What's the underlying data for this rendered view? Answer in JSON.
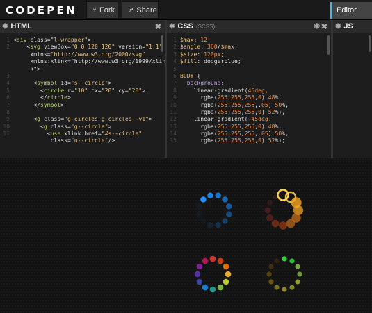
{
  "app": {
    "logo_text": "CODEPEN"
  },
  "toolbar": {
    "fork_label": "Fork",
    "share_label": "Share",
    "editor_label": "Editor"
  },
  "panels": {
    "html": {
      "title": "HTML"
    },
    "css": {
      "title": "CSS",
      "subtitle": "(SCSS)"
    },
    "js": {
      "title": "JS"
    }
  },
  "html_code": [
    {
      "n": "1",
      "t": "<div class=\"l-wrapper\">"
    },
    {
      "n": "2",
      "t": "    <svg viewBox=\"0 0 120 120\" version=\"1.1\""
    },
    {
      "n": "",
      "t": "     xmlns=\"http://www.w3.org/2000/svg\""
    },
    {
      "n": "",
      "t": "     xmlns:xlink=\"http://www.w3.org/1999/xlin"
    },
    {
      "n": "",
      "t": "     k\">"
    },
    {
      "n": "3",
      "t": ""
    },
    {
      "n": "4",
      "t": "      <symbol id=\"s--circle\">"
    },
    {
      "n": "5",
      "t": "        <circle r=\"10\" cx=\"20\" cy=\"20\">"
    },
    {
      "n": "6",
      "t": "        </circle>"
    },
    {
      "n": "7",
      "t": "      </symbol>"
    },
    {
      "n": "8",
      "t": ""
    },
    {
      "n": "9",
      "t": "      <g class=\"g-circles g-circles--v1\">"
    },
    {
      "n": "10",
      "t": "        <g class=\"g--circle\">"
    },
    {
      "n": "11",
      "t": "          <use xlink:href=\"#s--circle\""
    },
    {
      "n": "",
      "t": "           class=\"u--circle\"/>"
    }
  ],
  "css_code": [
    {
      "n": "1",
      "t": "$max: 12;"
    },
    {
      "n": "2",
      "t": "$angle: 360/$max;"
    },
    {
      "n": "3",
      "t": "$size: 120px;"
    },
    {
      "n": "4",
      "t": "$fill: dodgerblue;"
    },
    {
      "n": "5",
      "t": ""
    },
    {
      "n": "6",
      "t": "BODY {"
    },
    {
      "n": "7",
      "t": "  background:"
    },
    {
      "n": "8",
      "t": "    linear-gradient(45deg,"
    },
    {
      "n": "9",
      "t": "      rgba(255,255,255,0) 48%,"
    },
    {
      "n": "10",
      "t": "      rgba(255,255,255,.05) 50%,"
    },
    {
      "n": "11",
      "t": "      rgba(255,255,255,0) 52%),"
    },
    {
      "n": "12",
      "t": "    linear-gradient(-45deg,"
    },
    {
      "n": "13",
      "t": "      rgba(255,255,255,0) 48%,"
    },
    {
      "n": "14",
      "t": "      rgba(255,255,255,.05) 50%,"
    },
    {
      "n": "15",
      "t": "      rgba(255,255,255,0) 52%);"
    }
  ],
  "spinners": [
    {
      "kind": "blue",
      "colors": [
        "#1e90ff"
      ]
    },
    {
      "kind": "orange-scaled",
      "colors": [
        "#ffd34d",
        "#f5a623",
        "#e07b1a",
        "#c84b1c",
        "#a52f21",
        "#7d2a25"
      ]
    },
    {
      "kind": "rainbow",
      "colors": [
        "#e53935",
        "#d84315",
        "#f57c00",
        "#fbc02d",
        "#cddc39",
        "#8bc34a",
        "#26a69a",
        "#1e88e5",
        "#3949ab",
        "#5e35b1",
        "#8e24aa",
        "#c2185b"
      ]
    },
    {
      "kind": "green",
      "colors": [
        "#2ecc40",
        "#8bc34a",
        "#cddc39",
        "#ffeb3b",
        "#ffc107",
        "#ff9800"
      ]
    }
  ],
  "colors": {
    "accent": "#47b7e8",
    "header_bg": "#1a1a1a",
    "panel_bg": "#1d1d1d",
    "preview_bg": "#131313"
  }
}
